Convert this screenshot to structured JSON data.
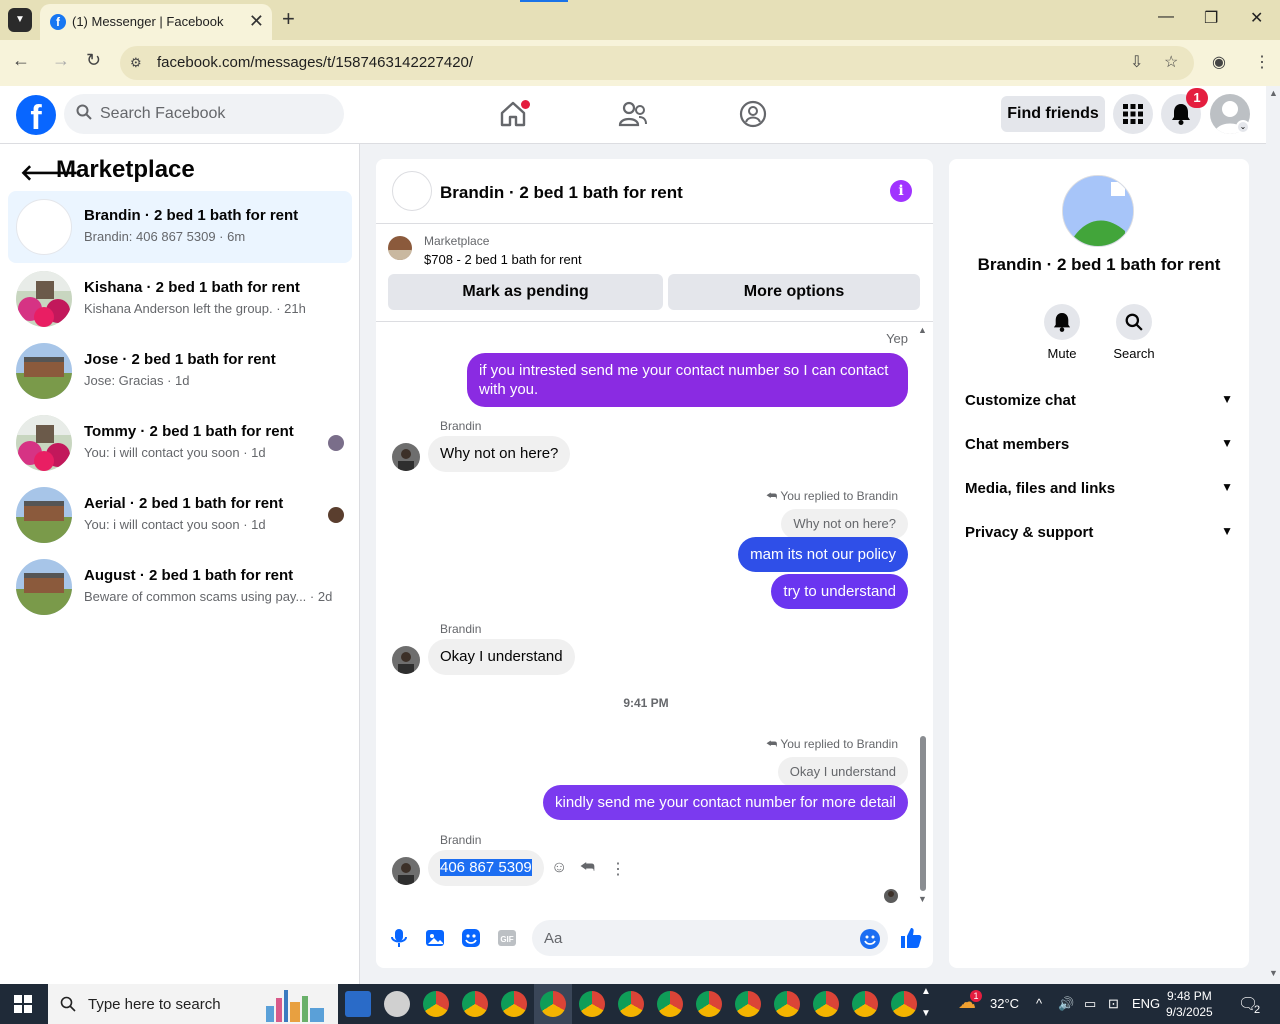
{
  "browser": {
    "tab_title": "(1) Messenger | Facebook",
    "url": "facebook.com/messages/t/1587463142227420/"
  },
  "fb_header": {
    "search_placeholder": "Search Facebook",
    "find_friends": "Find friends",
    "notification_count": "1"
  },
  "left_pane": {
    "title": "Marketplace",
    "conversations": [
      {
        "name": "Brandin · 2 bed 1 bath for rent",
        "preview": "Brandin: 406 867 5309 · 6m"
      },
      {
        "name": "Kishana · 2 bed 1 bath for rent",
        "preview": "Kishana Anderson left the group. · 21h"
      },
      {
        "name": "Jose · 2 bed 1 bath for rent",
        "preview": "Jose: Gracias · 1d"
      },
      {
        "name": "Tommy · 2 bed 1 bath for rent",
        "preview": "You: i will contact you soon · 1d"
      },
      {
        "name": "Aerial · 2 bed 1 bath for rent",
        "preview": "You: i will contact you soon · 1d"
      },
      {
        "name": "August · 2 bed 1 bath for rent",
        "preview": "Beware of common scams using pay... · 2d"
      }
    ]
  },
  "chat": {
    "title": "Brandin · 2 bed 1 bath for rent",
    "listing_label": "Marketplace",
    "listing_price": "$708 - 2 bed 1 bath for rent",
    "mark_pending": "Mark as pending",
    "more_options": "More options",
    "yep": "Yep",
    "msg_out_1": "if you intrested send me your contact number so I can contact with you.",
    "sender": "Brandin",
    "msg_in_1": "Why not on here?",
    "replied_label": "You replied to Brandin",
    "quote_1": "Why not on here?",
    "msg_out_2": "mam its not our policy",
    "msg_out_3": "try to understand",
    "msg_in_2": "Okay I understand",
    "timestamp": "9:41 PM",
    "quote_2": "Okay I understand",
    "msg_out_4": "kindly send me your contact number for more detail",
    "msg_in_3": "406 867 5309",
    "composer_placeholder": "Aa"
  },
  "right_pane": {
    "name": "Brandin · 2 bed 1 bath for rent",
    "mute": "Mute",
    "search": "Search",
    "sections": [
      "Customize chat",
      "Chat members",
      "Media, files and links",
      "Privacy & support"
    ]
  },
  "taskbar": {
    "search_placeholder": "Type here to search",
    "temperature": "32°C",
    "language": "ENG",
    "time": "9:48 PM",
    "date": "9/3/2025",
    "notif_count": "2",
    "weather_badge": "1"
  },
  "colors": {
    "fb_blue": "#0866ff",
    "bubble_purple": "#8a2be2",
    "bubble_blue": "#2f4fe8",
    "selection": "#1c6ef2",
    "chrome_bg": "#e6e0b8"
  }
}
